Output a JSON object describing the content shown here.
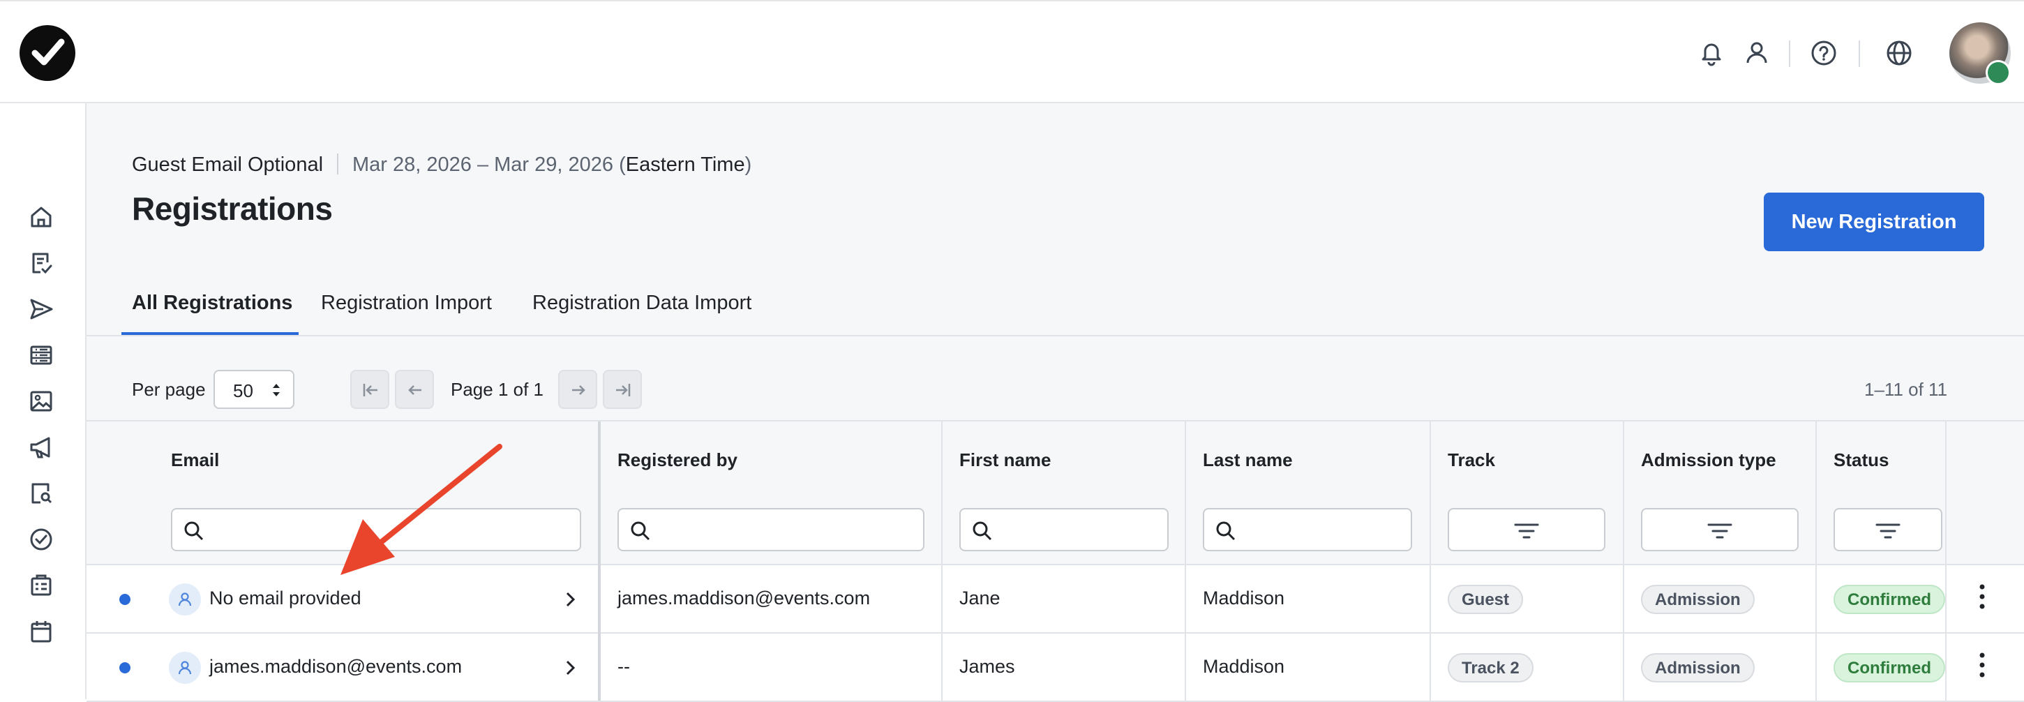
{
  "topbar": {
    "icons": [
      "bell-icon",
      "user-icon",
      "help-icon",
      "globe-icon"
    ]
  },
  "sidebar": {
    "icons": [
      "home-icon",
      "checklist-icon",
      "send-icon",
      "list-icon",
      "image-icon",
      "megaphone-icon",
      "badge-search-icon",
      "check-circle-icon",
      "clipboard-icon",
      "calendar-icon"
    ]
  },
  "header": {
    "event_name": "Guest Email Optional",
    "dates": "Mar 28, 2026 – Mar 29, 2026 (",
    "timezone": "Eastern Time",
    "dates_close": ")",
    "title": "Registrations",
    "new_button": "New Registration"
  },
  "tabs": [
    {
      "label": "All Registrations",
      "active": true
    },
    {
      "label": "Registration Import",
      "active": false
    },
    {
      "label": "Registration Data Import",
      "active": false
    }
  ],
  "pagination": {
    "per_page_label": "Per page",
    "per_page_value": "50",
    "page_text": "Page 1 of 1",
    "range_text": "1–11 of 11"
  },
  "table": {
    "columns": [
      "Email",
      "Registered by",
      "First name",
      "Last name",
      "Track",
      "Admission type",
      "Status"
    ],
    "rows": [
      {
        "email": "No email provided",
        "registered_by": "james.maddison@events.com",
        "first_name": "Jane",
        "last_name": "Maddison",
        "track": "Guest",
        "admission": "Admission",
        "status": "Confirmed"
      },
      {
        "email": "james.maddison@events.com",
        "registered_by": "--",
        "first_name": "James",
        "last_name": "Maddison",
        "track": "Track 2",
        "admission": "Admission",
        "status": "Confirmed"
      }
    ]
  },
  "colors": {
    "accent": "#2a6ad8",
    "status_confirmed_bg": "#d9f3dd",
    "annotation_arrow": "#e8452c"
  }
}
